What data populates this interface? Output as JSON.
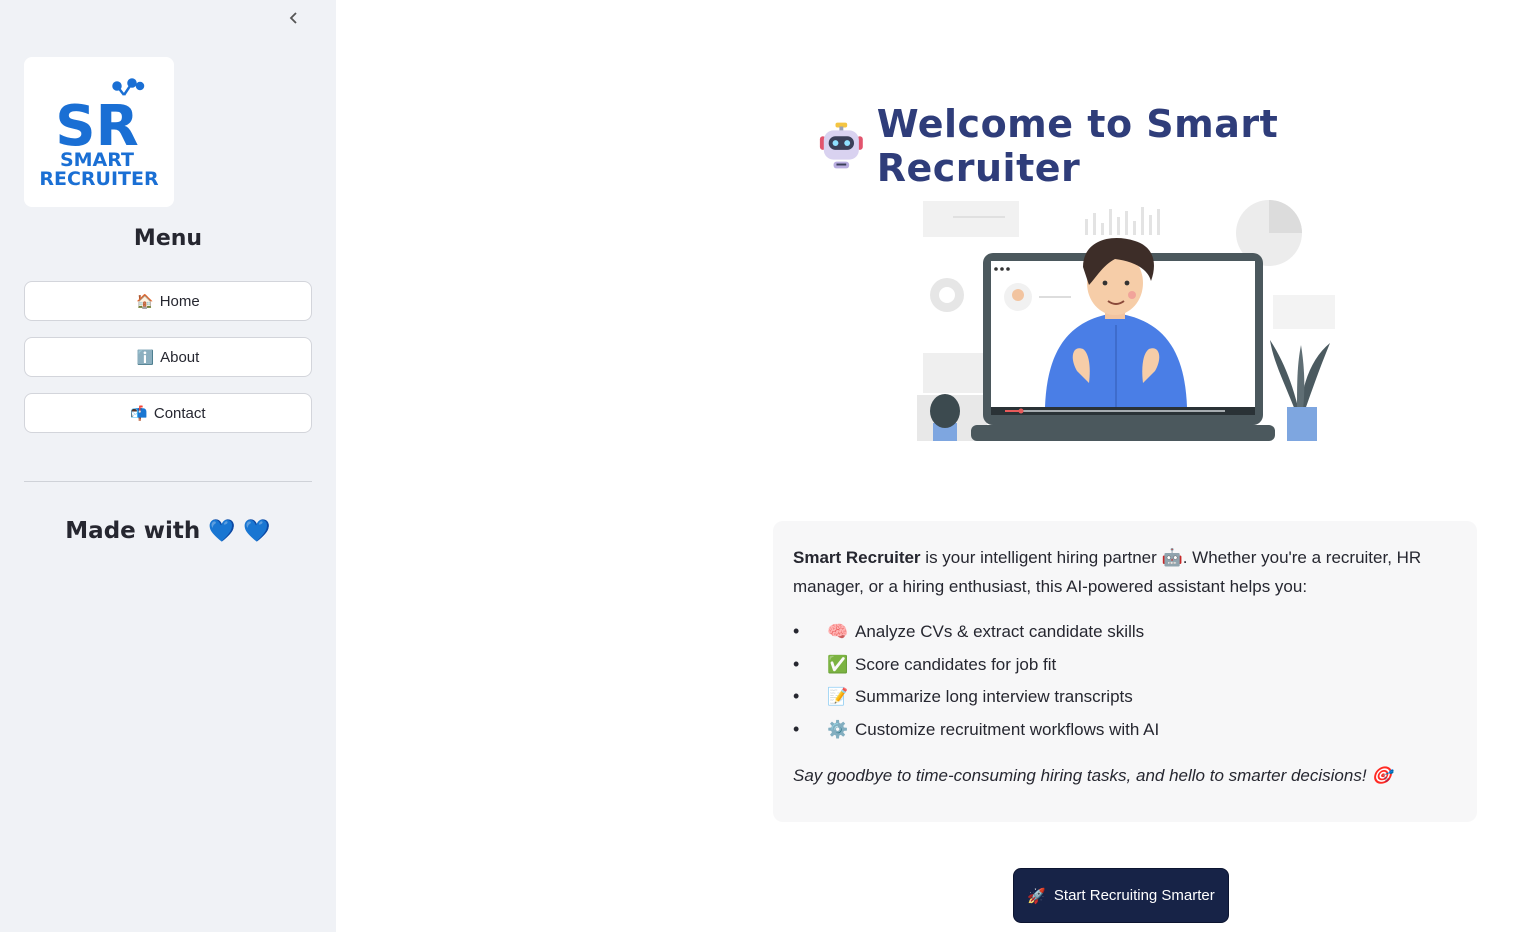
{
  "sidebar": {
    "collapse_icon": "chevron-left-icon",
    "logo": {
      "letters": "SR",
      "line1": "SMART",
      "line2": "RECRUITER"
    },
    "menu_title": "Menu",
    "items": [
      {
        "icon": "🏠",
        "label": "Home"
      },
      {
        "icon": "ℹ️",
        "label": "About"
      },
      {
        "icon": "📬",
        "label": "Contact"
      }
    ],
    "made_with": "Made with",
    "hearts": "💙 💙"
  },
  "main": {
    "title": "Welcome to Smart Recruiter",
    "intro_bold": "Smart Recruiter",
    "intro_part1": " is your intelligent hiring partner ",
    "intro_emoji": "🤖",
    "intro_part2": ". Whether you're a recruiter, HR manager, or a hiring enthusiast, this AI-powered assistant helps you:",
    "features": [
      {
        "icon": "🧠",
        "text": "Analyze CVs & extract candidate skills"
      },
      {
        "icon": "✅",
        "text": "Score candidates for job fit"
      },
      {
        "icon": "📝",
        "text": "Summarize long interview transcripts"
      },
      {
        "icon": "⚙️",
        "text": "Customize recruitment workflows with AI"
      }
    ],
    "closing": "Say goodbye to time-consuming hiring tasks, and hello to smarter decisions!",
    "closing_emoji": "🎯",
    "cta_icon": "🚀",
    "cta_label": "Start Recruiting Smarter"
  },
  "colors": {
    "sidebar_bg": "#f0f2f6",
    "title": "#2f3d7a",
    "cta_bg": "#172347",
    "logo_blue": "#1a6fd4"
  }
}
